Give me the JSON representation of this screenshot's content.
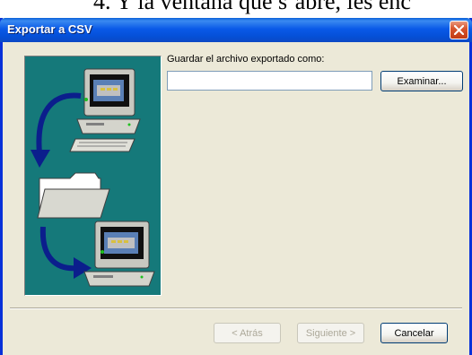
{
  "page_fragment_text": "4.  Y la ventana que s’abre, les enc",
  "dialog": {
    "title": "Exportar a CSV",
    "save_label": "Guardar el archivo exportado como:",
    "file_value": "",
    "browse_label": "Examinar...",
    "back_label": "< Atrás",
    "next_label": "Siguiente >",
    "cancel_label": "Cancelar"
  },
  "colors": {
    "illustration_bg": "#15797a",
    "arrow": "#0b1e8c",
    "titlebar": "#0a5ae8",
    "close_button": "#d8562f"
  },
  "icons": [
    "computer-icon",
    "folder-icon",
    "curved-arrow-icon",
    "close-icon"
  ]
}
